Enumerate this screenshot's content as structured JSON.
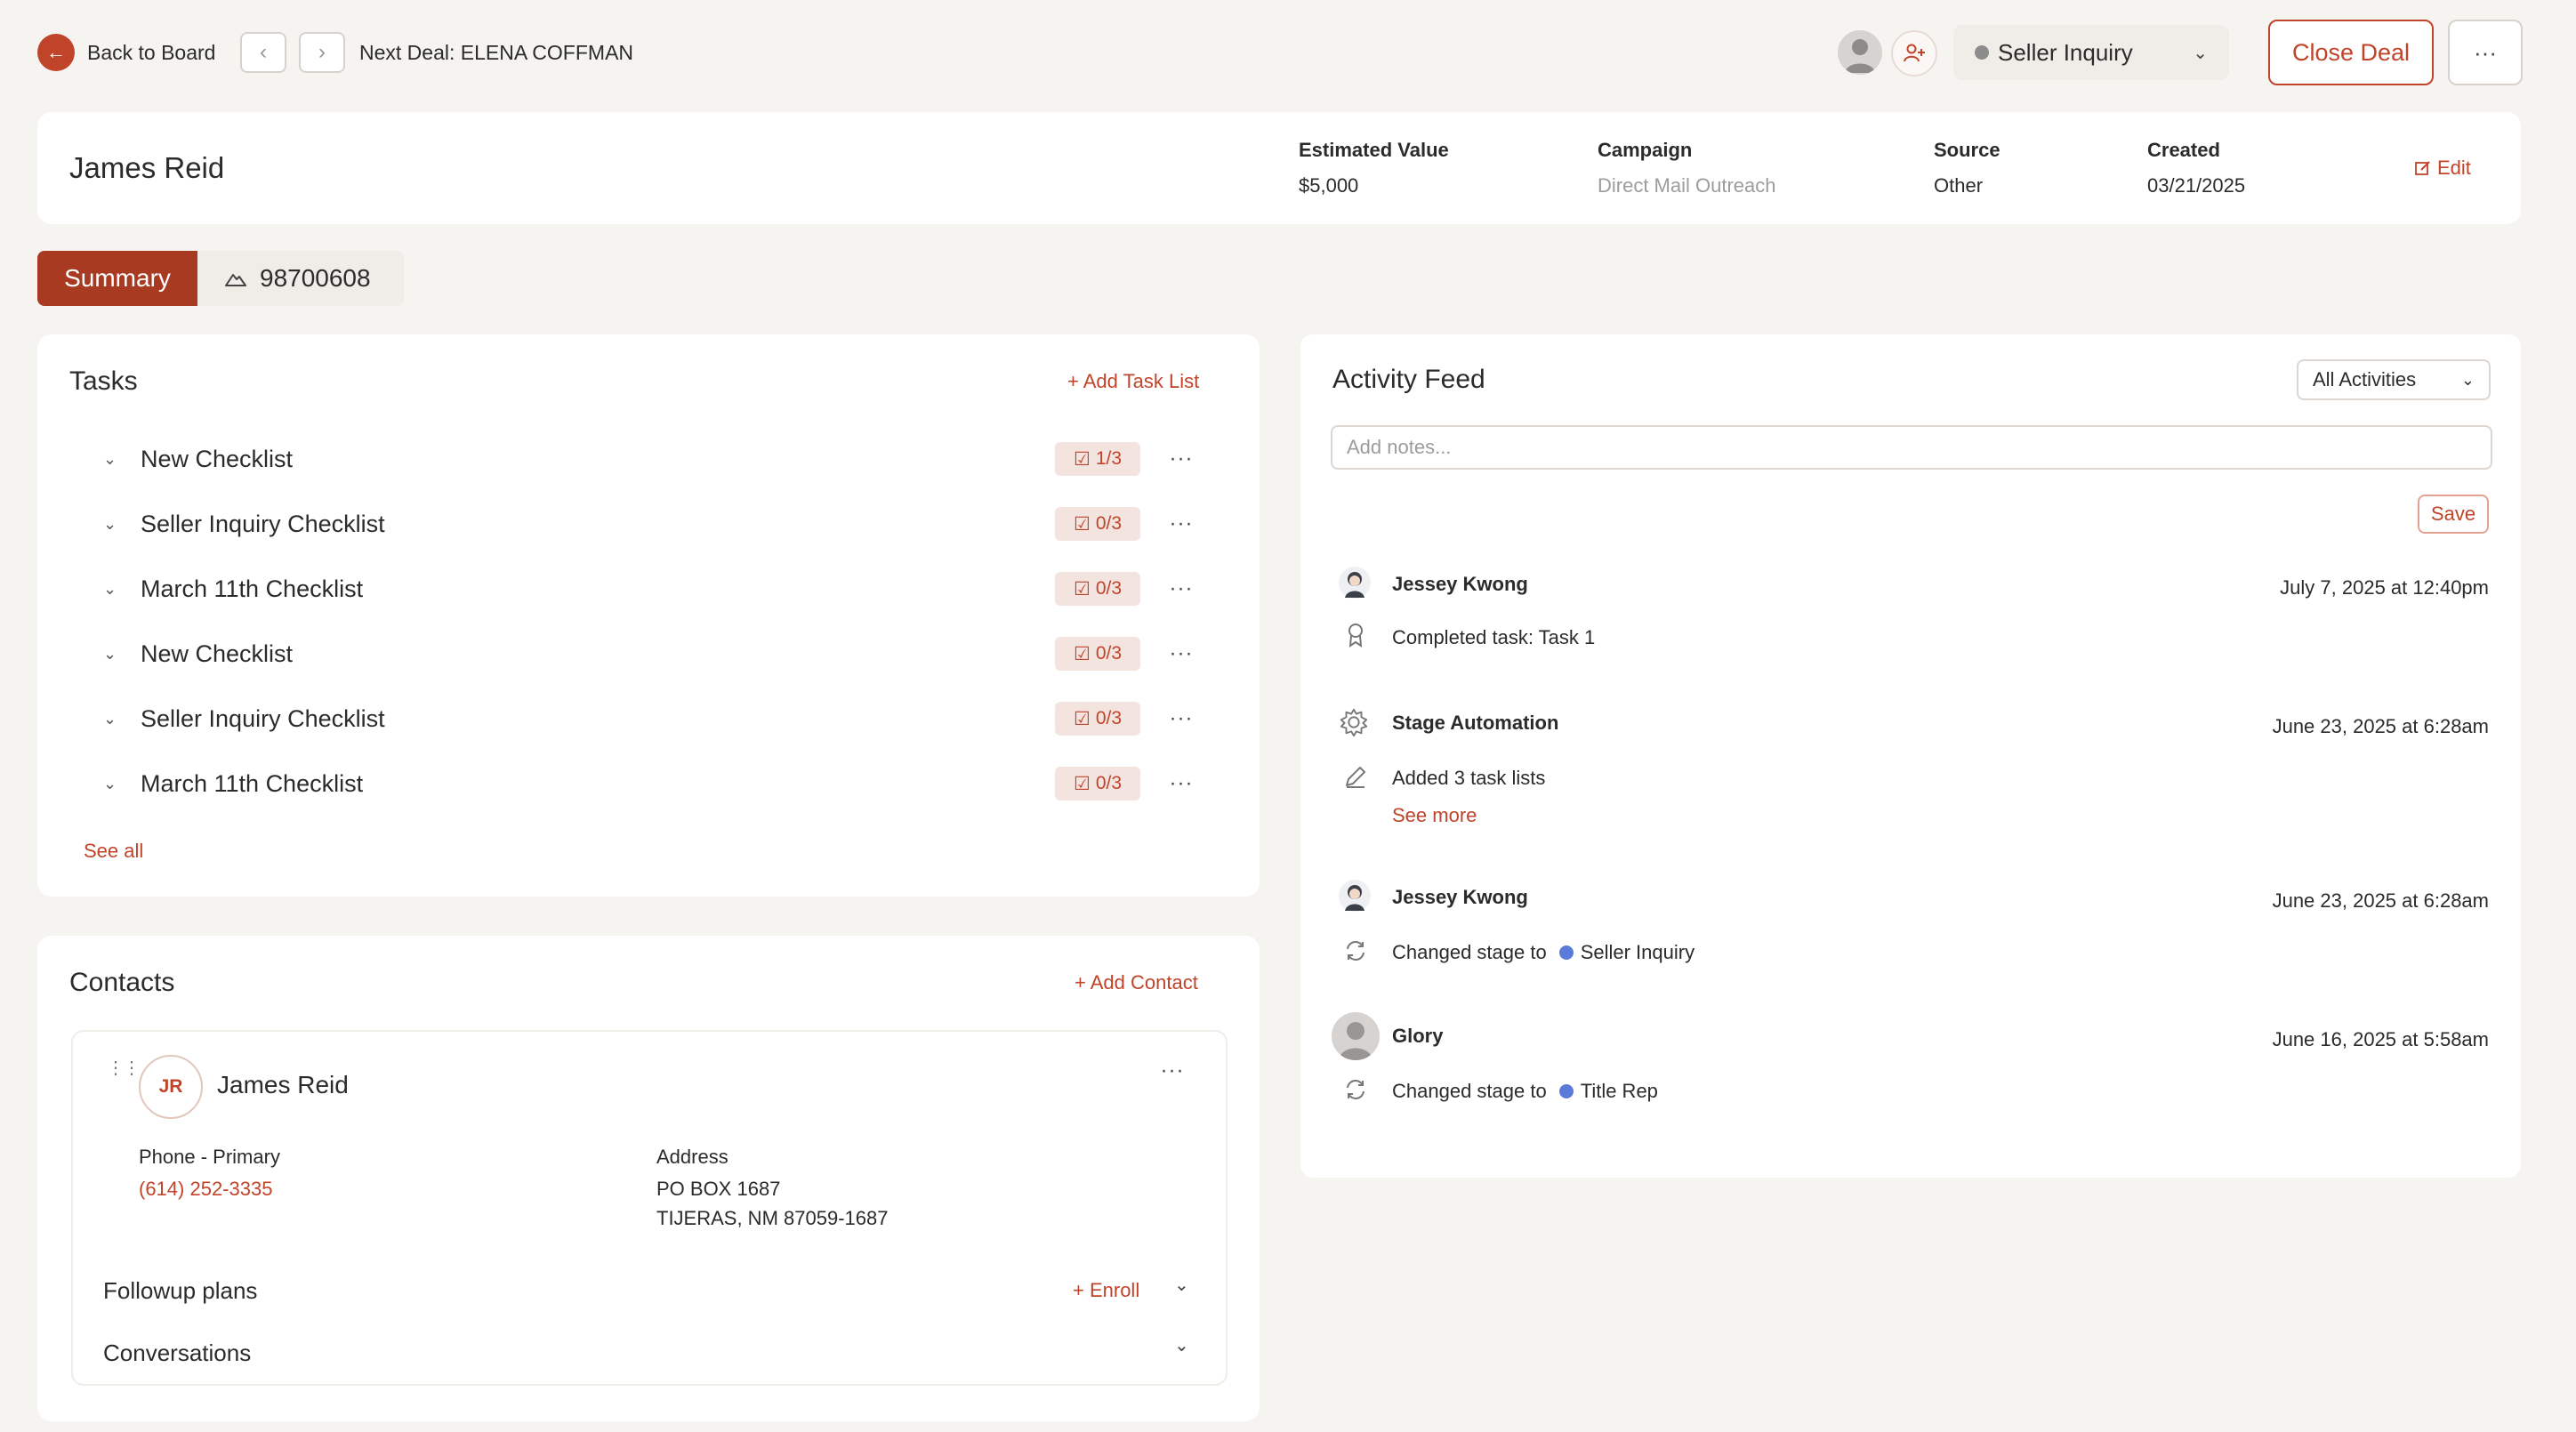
{
  "topbar": {
    "back_label": "Back to Board",
    "prev_icon": "chevron-left-icon",
    "next_icon": "chevron-right-icon",
    "next_deal": "Next Deal: ELENA COFFMAN",
    "stage": "Seller Inquiry",
    "close_deal": "Close Deal",
    "more": "···"
  },
  "deal": {
    "name": "James Reid",
    "meta": [
      {
        "label": "Estimated Value",
        "value": "$5,000"
      },
      {
        "label": "Campaign",
        "value": "Direct Mail Outreach"
      },
      {
        "label": "Source",
        "value": "Other"
      },
      {
        "label": "Created",
        "value": "03/21/2025"
      }
    ],
    "edit_label": "Edit"
  },
  "tabs": {
    "summary": "Summary",
    "property_id": "98700608"
  },
  "tasks": {
    "title": "Tasks",
    "add_label": "+ Add Task List",
    "lists": [
      {
        "name": "New Checklist",
        "progress": "1/3"
      },
      {
        "name": "Seller Inquiry Checklist",
        "progress": "0/3"
      },
      {
        "name": "March 11th Checklist",
        "progress": "0/3"
      },
      {
        "name": "New Checklist",
        "progress": "0/3"
      },
      {
        "name": "Seller Inquiry Checklist",
        "progress": "0/3"
      },
      {
        "name": "March 11th Checklist",
        "progress": "0/3"
      }
    ],
    "see_all": "See all"
  },
  "contacts": {
    "title": "Contacts",
    "add_label": "+ Add Contact",
    "contact": {
      "initials": "JR",
      "name": "James Reid",
      "phone_label": "Phone - Primary",
      "phone": "(614) 252-3335",
      "address_label": "Address",
      "address_line1": "PO BOX 1687",
      "address_line2": "TIJERAS, NM 87059-1687"
    },
    "followup_label": "Followup plans",
    "enroll_label": "+ Enroll",
    "conversations_label": "Conversations"
  },
  "activity": {
    "title": "Activity Feed",
    "filter": "All Activities",
    "notes_placeholder": "Add notes...",
    "save_label": "Save",
    "items": [
      {
        "author": "Jessey Kwong",
        "date": "July 7, 2025 at 12:40pm",
        "text": "Completed task: Task 1"
      },
      {
        "author": "Stage Automation",
        "date": "June 23, 2025 at 6:28am",
        "text": "Added 3 task lists",
        "see_more": "See more"
      },
      {
        "author": "Jessey Kwong",
        "date": "June 23, 2025 at 6:28am",
        "text": "Changed stage to",
        "stage": "Seller Inquiry"
      },
      {
        "author": "Glory",
        "date": "June 16, 2025 at 5:58am",
        "text": "Changed stage to",
        "stage": "Title Rep"
      }
    ]
  },
  "colors": {
    "accent": "#c0442a",
    "summary_tab": "#a83a22",
    "stage_dot": "#5b7bdb"
  }
}
